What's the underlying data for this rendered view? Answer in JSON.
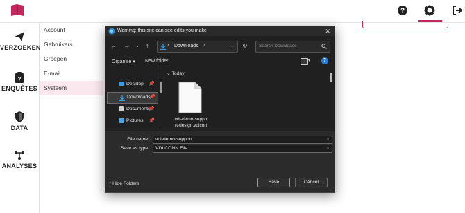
{
  "app": {
    "nav_rail": [
      {
        "label": "VERZOEKEN",
        "icon": "paper-plane-icon"
      },
      {
        "label": "ENQUÊTES",
        "icon": "clipboard-icon"
      },
      {
        "label": "DATA",
        "icon": "shield-icon"
      },
      {
        "label": "ANALYSES",
        "icon": "network-icon"
      }
    ],
    "subnav": [
      {
        "label": "Account",
        "active": false
      },
      {
        "label": "Gebruikers",
        "active": false
      },
      {
        "label": "Groepen",
        "active": false
      },
      {
        "label": "E-mail",
        "active": false
      },
      {
        "label": "Systeem",
        "active": true
      }
    ],
    "top_icons": [
      "help-icon",
      "gear-icon",
      "logout-icon"
    ],
    "accent_color": "#c7255e"
  },
  "dialog": {
    "title": "Warning: this site can see edits you make",
    "path_folder": "Downloads",
    "search_placeholder": "Search Downloads",
    "organise_label": "Organise",
    "new_folder_label": "New folder",
    "tree": [
      {
        "label": "Desktop",
        "icon": "desktop-folder-icon",
        "selected": false
      },
      {
        "label": "Downloads",
        "icon": "download-icon",
        "selected": true
      },
      {
        "label": "Documents",
        "icon": "documents-icon",
        "selected": false
      },
      {
        "label": "Pictures",
        "icon": "pictures-icon",
        "selected": false
      }
    ],
    "group_header": "Today",
    "file": {
      "name_line1": "vdl-demo-suppo",
      "name_line2": "rt-design.vdlcon"
    },
    "file_name_label": "File name:",
    "file_name_value": "vdl-demo-support",
    "save_type_label": "Save as type:",
    "save_type_value": "VDLCONN File",
    "hide_folders_label": "Hide Folders",
    "save_label": "Save",
    "cancel_label": "Cancel"
  }
}
